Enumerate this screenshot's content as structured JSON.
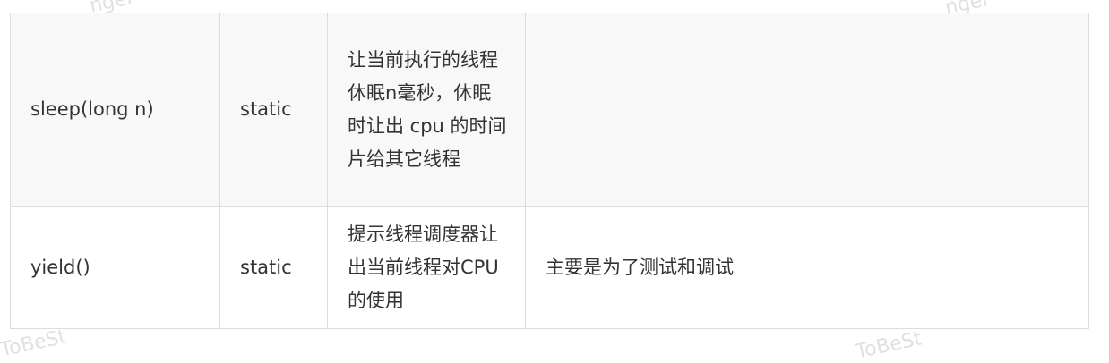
{
  "table": {
    "rows": [
      {
        "method": "sleep(long n)",
        "modifier": "static",
        "description": "让当前执行的线程休眠n毫秒，休眠时让出 cpu 的时间片给其它线程",
        "note": ""
      },
      {
        "method": "yield()",
        "modifier": "static",
        "description": "提示线程调度器让出当前线程对CPU的使用",
        "note": "主要是为了测试和调试"
      }
    ]
  },
  "watermarks": [
    "ngel",
    "ngel",
    "ToBeSt",
    "ToBeSt"
  ]
}
